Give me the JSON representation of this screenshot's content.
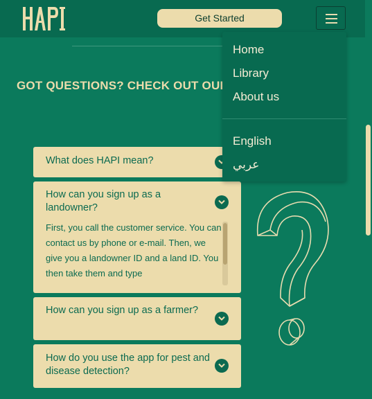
{
  "header": {
    "logo_text": "HAPI",
    "cta_label": "Get Started"
  },
  "menu": {
    "items": [
      "Home",
      "Library",
      "About us"
    ],
    "languages": [
      "English",
      "عربي"
    ]
  },
  "section": {
    "title": "GOT QUESTIONS? CHECK OUT OUR FAQS"
  },
  "faqs": [
    {
      "question": "What does HAPI mean?"
    },
    {
      "question": "How can you sign up as a landowner?",
      "answer": "First, you call the customer service. You can contact us by phone or e-mail. Then, we give you a landowner ID and a land ID. You then take them and type"
    },
    {
      "question": "How can you sign up as a farmer?"
    },
    {
      "question": "How do you use the app for pest and disease detection?"
    }
  ],
  "colors": {
    "background": "#0b7a5c",
    "header": "#086a50",
    "cream": "#ecdcac",
    "text_green": "#0b6a50"
  }
}
